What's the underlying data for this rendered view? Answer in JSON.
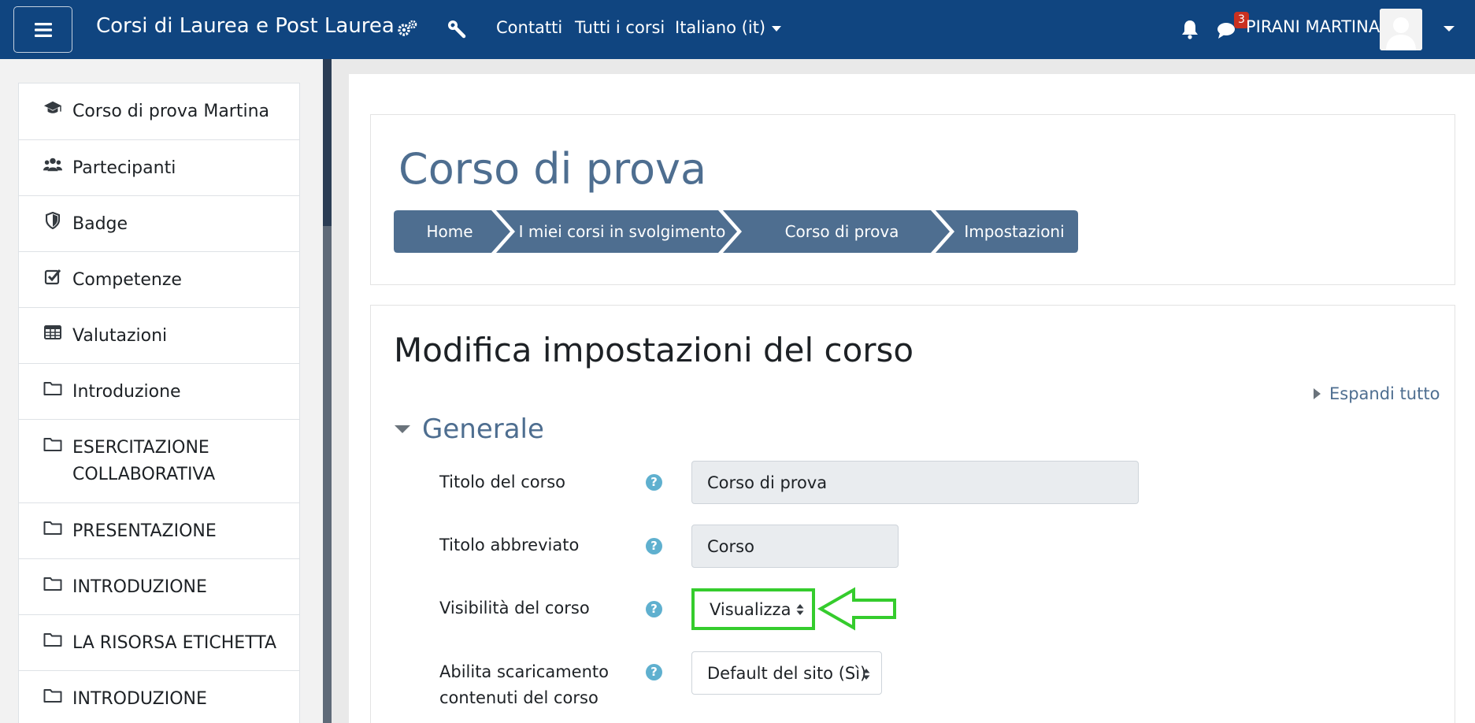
{
  "navbar": {
    "brand": "Corsi di Laurea e Post Laurea",
    "links": [
      "Contatti",
      "Tutti i corsi",
      "Italiano (it)"
    ],
    "message_count": "3",
    "username": "PIRANI MARTINA",
    "bg_color": "#104580"
  },
  "drawer": {
    "items": [
      {
        "label": "Corso di prova Martina",
        "icon": "graduation-cap-icon"
      },
      {
        "label": "Partecipanti",
        "icon": "users-icon"
      },
      {
        "label": "Badge",
        "icon": "shield-icon"
      },
      {
        "label": "Competenze",
        "icon": "check-square-icon"
      },
      {
        "label": "Valutazioni",
        "icon": "table-icon"
      },
      {
        "label": "Introduzione",
        "icon": "folder-icon"
      },
      {
        "label": "ESERCITAZIONE COLLABORATIVA",
        "icon": "folder-icon"
      },
      {
        "label": "PRESENTAZIONE",
        "icon": "folder-icon"
      },
      {
        "label": "INTRODUZIONE",
        "icon": "folder-icon"
      },
      {
        "label": "LA RISORSA ETICHETTA",
        "icon": "folder-icon"
      },
      {
        "label": "INTRODUZIONE",
        "icon": "folder-icon"
      }
    ]
  },
  "page": {
    "course_title": "Corso di prova",
    "breadcrumb": [
      "Home",
      "I miei corsi in svolgimento",
      "Corso di prova",
      "Impostazioni"
    ],
    "form_title": "Modifica impostazioni del corso",
    "expand_all": "Espandi tutto",
    "section_title": "Generale",
    "fields": {
      "fullname_label": "Titolo del corso",
      "fullname_value": "Corso di prova",
      "shortname_label": "Titolo abbreviato",
      "shortname_value": "Corso",
      "visibility_label": "Visibilità del corso",
      "visibility_value": "Visualizza",
      "download_label_line1": "Abilita scaricamento",
      "download_label_line2": "contenuti del corso",
      "download_value": "Default del sito (Sì)"
    }
  },
  "colors": {
    "accent": "#4e6e90",
    "help": "#5fb0cf",
    "highlight": "#35cc2d"
  }
}
